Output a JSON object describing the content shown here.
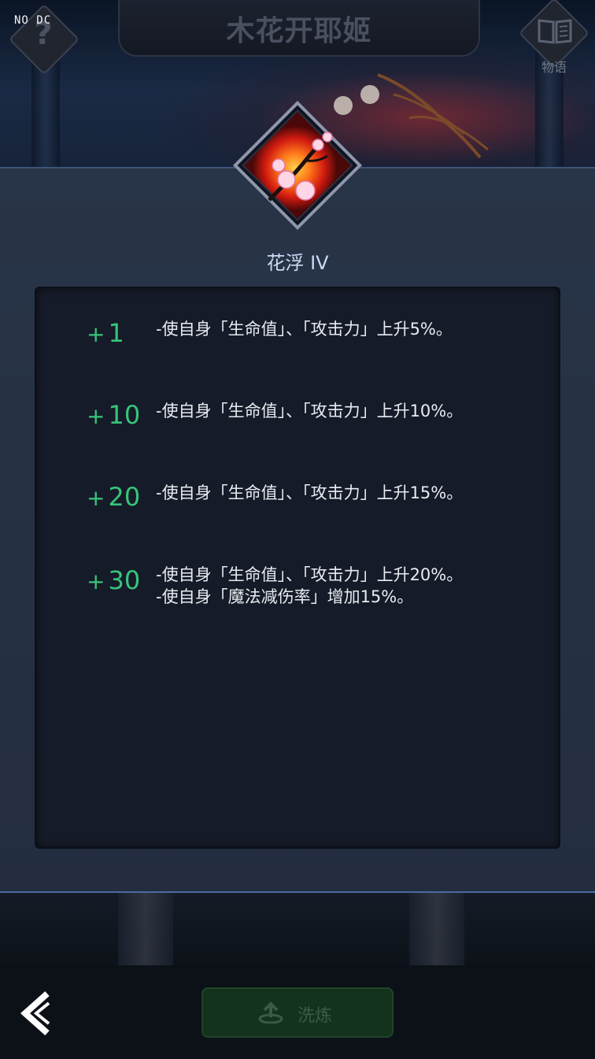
{
  "overlay_tag": "NO DC",
  "header": {
    "title": "木花开耶姬",
    "help_glyph": "?",
    "story_label": "物语"
  },
  "skill": {
    "name": "花浮 IV",
    "icon": "cherry-blossom-flame-icon"
  },
  "bonuses": [
    {
      "level": "1",
      "lines": [
        "-使自身「生命值」、「攻击力」上升5%。"
      ]
    },
    {
      "level": "10",
      "lines": [
        "-使自身「生命值」、「攻击力」上升10%。"
      ]
    },
    {
      "level": "20",
      "lines": [
        "-使自身「生命值」、「攻击力」上升15%。"
      ]
    },
    {
      "level": "30",
      "lines": [
        "-使自身「生命值」、「攻击力」上升20%。",
        "-使自身「魔法减伤率」增加15%。"
      ]
    }
  ],
  "footer": {
    "refine_label": "洗炼",
    "back_icon": "back-arrow-icon"
  },
  "colors": {
    "accent_green": "#37c47b",
    "skill_name": "#cdd8f5"
  }
}
